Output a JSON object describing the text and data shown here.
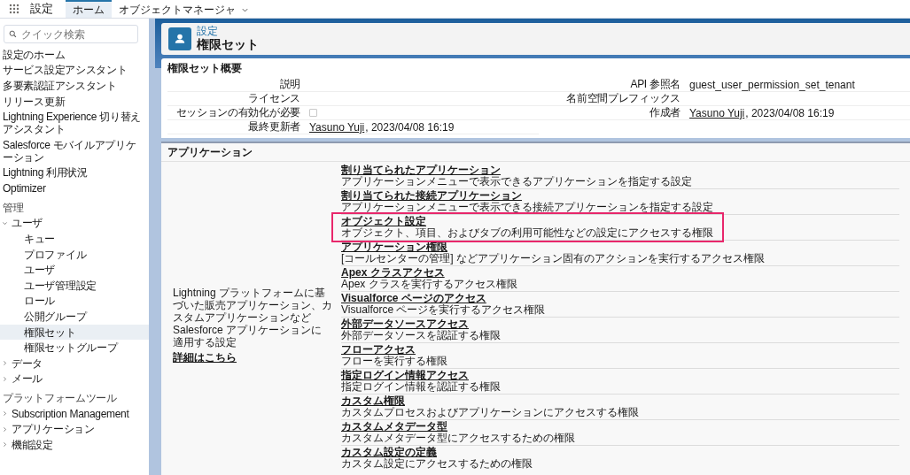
{
  "top_bar": {
    "app_title": "設定",
    "tabs": [
      {
        "label": "ホーム",
        "selected": true,
        "dropdown": false
      },
      {
        "label": "オブジェクトマネージャ",
        "selected": false,
        "dropdown": true
      }
    ]
  },
  "sidebar": {
    "search": {
      "placeholder": "クイック検索"
    },
    "items": [
      {
        "kind": "link",
        "label": "設定のホーム",
        "selected": false
      },
      {
        "kind": "link",
        "label": "サービス設定アシスタント",
        "selected": false
      },
      {
        "kind": "link",
        "label": "多要素認証アシスタント",
        "selected": false
      },
      {
        "kind": "link",
        "label": "リリース更新",
        "selected": false
      },
      {
        "kind": "link",
        "label": "Lightning Experience 切り替えアシスタント",
        "selected": false
      },
      {
        "kind": "link",
        "label": "Salesforce モバイルアプリケーション",
        "selected": false
      },
      {
        "kind": "link",
        "label": "Lightning 利用状況",
        "selected": false
      },
      {
        "kind": "link",
        "label": "Optimizer",
        "selected": false
      },
      {
        "kind": "section",
        "label": "管理"
      },
      {
        "kind": "group",
        "label": "ユーザ",
        "expanded": true,
        "children": [
          {
            "label": "キュー",
            "selected": false
          },
          {
            "label": "プロファイル",
            "selected": false
          },
          {
            "label": "ユーザ",
            "selected": false
          },
          {
            "label": "ユーザ管理設定",
            "selected": false
          },
          {
            "label": "ロール",
            "selected": false
          },
          {
            "label": "公開グループ",
            "selected": false
          },
          {
            "label": "権限セット",
            "selected": true
          },
          {
            "label": "権限セットグループ",
            "selected": false
          }
        ]
      },
      {
        "kind": "group",
        "label": "データ",
        "expanded": false
      },
      {
        "kind": "group",
        "label": "メール",
        "expanded": false
      },
      {
        "kind": "section",
        "label": "プラットフォームツール"
      },
      {
        "kind": "group",
        "label": "Subscription Management",
        "expanded": false
      },
      {
        "kind": "group",
        "label": "アプリケーション",
        "expanded": false
      },
      {
        "kind": "group",
        "label": "機能設定",
        "expanded": false
      }
    ]
  },
  "header": {
    "breadcrumb": "設定",
    "title": "権限セット"
  },
  "overview": {
    "title": "権限セット概要",
    "left_fields": [
      {
        "kind": "text",
        "label": "説明"
      },
      {
        "kind": "text",
        "label": "ライセンス"
      },
      {
        "kind": "checkbox",
        "label": "セッションの有効化が必要",
        "checked": false
      },
      {
        "kind": "user",
        "label": "最終更新者",
        "link": "Yasuno Yuji",
        "suffix": ", 2023/04/08 16:19"
      }
    ],
    "right_fields": [
      {
        "kind": "text",
        "label": "API 参照名",
        "value": "guest_user_permission_set_tenant"
      },
      {
        "kind": "text",
        "label": "名前空間プレフィックス"
      },
      {
        "kind": "user",
        "label": "作成者",
        "link": "Yasuno Yuji",
        "suffix": ", 2023/04/08 16:19"
      }
    ]
  },
  "applications": {
    "title": "アプリケーション",
    "description": "Lightning プラットフォームに基づいた販売アプリケーション、カスタムアプリケーションなど Salesforce アプリケーションに適用する設定",
    "more_link": "詳細はこちら",
    "items": [
      {
        "title": "割り当てられたアプリケーション",
        "description": "アプリケーションメニューで表示できるアプリケーションを指定する設定",
        "highlighted": false
      },
      {
        "title": "割り当てられた接続アプリケーション",
        "description": "アプリケーションメニューで表示できる接続アプリケーションを指定する設定",
        "highlighted": false
      },
      {
        "title": "オブジェクト設定",
        "description": "オブジェクト、項目、およびタブの利用可能性などの設定にアクセスする権限",
        "highlighted": true
      },
      {
        "title": "アプリケーション権限",
        "description": "[コールセンターの管理] などアプリケーション固有のアクションを実行するアクセス権限",
        "highlighted": false
      },
      {
        "title": "Apex クラスアクセス",
        "description": "Apex クラスを実行するアクセス権限",
        "highlighted": false
      },
      {
        "title": "Visualforce ページのアクセス",
        "description": "Visualforce ページを実行するアクセス権限",
        "highlighted": false
      },
      {
        "title": "外部データソースアクセス",
        "description": "外部データソースを認証する権限",
        "highlighted": false
      },
      {
        "title": "フローアクセス",
        "description": "フローを実行する権限",
        "highlighted": false
      },
      {
        "title": "指定ログイン情報アクセス",
        "description": "指定ログイン情報を認証する権限",
        "highlighted": false
      },
      {
        "title": "カスタム権限",
        "description": "カスタムプロセスおよびアプリケーションにアクセスする権限",
        "highlighted": false
      },
      {
        "title": "カスタムメタデータ型",
        "description": "カスタムメタデータ型にアクセスするための権限",
        "highlighted": false
      },
      {
        "title": "カスタム設定の定義",
        "description": "カスタム設定にアクセスするための権限",
        "highlighted": false
      }
    ]
  }
}
